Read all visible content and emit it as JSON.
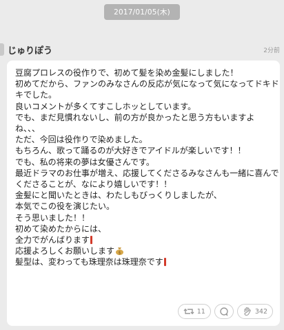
{
  "date_label": "2017/01/05(木)",
  "post": {
    "author": "じゅりぽう",
    "timestamp": "2分前",
    "lines": [
      "豆腐プロレスの役作りで、初めて髪を染め金髪にしました！",
      "初めてだから、ファンのみなさんの反応が気になって気になってドキド",
      "キでした。",
      "良いコメントが多くてすこしホッとしています。",
      "でも、まだ見慣れないし、前の方が良かったと思う方もいますよ",
      "ね、、、",
      "ただ、今回は役作りで染めました。",
      "もちろん、歌って踊るのが大好きでアイドルが楽しいです！！",
      "でも、私の将来の夢は女優さんです。",
      "最近ドラマのお仕事が増え、応援してくださるみなさんも一緒に喜んで",
      "くださることが、なにより嬉しいです！！",
      "金髪にと聞いたときは、わたしもびっくりしましたが、",
      "本気でこの役を演じたい。",
      "そう思いました！！",
      "初めて染めたからには、",
      "全力でがんばります",
      "応援よろしくお願いします",
      "髪型は、変わっても珠理奈は珠理奈です"
    ],
    "actions": {
      "retweet_count": "11",
      "like_count": "342"
    },
    "icons": {
      "retweet": "retweet-icon",
      "comment": "comment-icon",
      "like": "clap-hand-icon",
      "emoji_exclamation": "exclamation-emoji",
      "emoji_bag": "money-bag-emoji"
    }
  }
}
